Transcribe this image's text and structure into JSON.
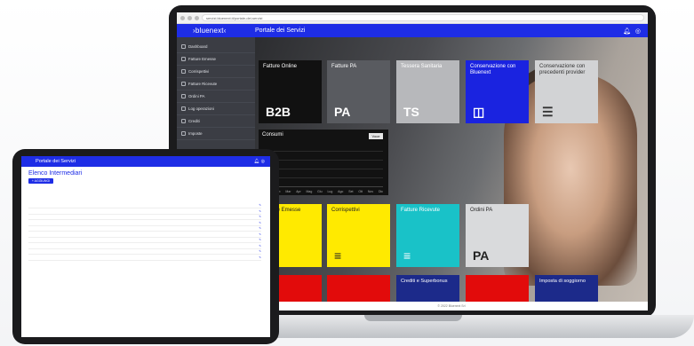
{
  "browser": {
    "url": "servizi.bluenext.it/portale-dei-servizi"
  },
  "app": {
    "brand": "›bluenext‹",
    "title": "Portale dei Servizi",
    "bell_icon": "bell-icon",
    "user_icon": "user-icon"
  },
  "sidebar": {
    "items": [
      {
        "label": "Dashboard"
      },
      {
        "label": "Fatture Emesse"
      },
      {
        "label": "Corrispettivi"
      },
      {
        "label": "Fatture Ricevute"
      },
      {
        "label": "Ordini PA"
      },
      {
        "label": "Log operazioni"
      },
      {
        "label": "Crediti"
      },
      {
        "label": "Imposte"
      }
    ]
  },
  "tiles": {
    "b2b": {
      "label": "Fatture Online",
      "icon": "B2B"
    },
    "fpa": {
      "label": "Fatture PA",
      "icon": "PA"
    },
    "ts": {
      "label": "Tessera Sanitaria",
      "icon": "TS"
    },
    "cons": {
      "label": "Conservazione con Bluenext",
      "icon": "◫"
    },
    "consprev": {
      "label": "Conservazione con precedenti provider",
      "icon": "☰"
    },
    "fe": {
      "label": "Fatture Emesse",
      "icon": "≡"
    },
    "comp": {
      "label": "Corrispettivi",
      "icon": "≡"
    },
    "fric": {
      "label": "Fatture Ricevute",
      "icon": "≡"
    },
    "opa": {
      "label": "Ordini PA",
      "icon": "PA"
    }
  },
  "consumi": {
    "title": "Consumi",
    "chip": "Voce",
    "months": [
      "Gen",
      "Feb",
      "Mar",
      "Apr",
      "Mag",
      "Giu",
      "Lug",
      "Ago",
      "Set",
      "Ott",
      "Nov",
      "Dic"
    ]
  },
  "row3": {
    "a": "",
    "b": "",
    "c": "Crediti e Superbonus",
    "d": "",
    "e": "Imposta di soggiorno"
  },
  "footer": {
    "text": "© 2022 Bluenext Srl"
  },
  "tablet": {
    "title": "Portale dei Servizi",
    "page_title": "Elenco Intermediari",
    "add_button": "+ AGGIUNGI",
    "columns": [
      "",
      "",
      "",
      "",
      "",
      "",
      "",
      ""
    ],
    "rows": [
      [
        "",
        "",
        "",
        "",
        "",
        "",
        "",
        ""
      ],
      [
        "",
        "",
        "",
        "",
        "",
        "",
        "",
        ""
      ],
      [
        "",
        "",
        "",
        "",
        "",
        "",
        "",
        ""
      ],
      [
        "",
        "",
        "",
        "",
        "",
        "",
        "",
        ""
      ],
      [
        "",
        "",
        "",
        "",
        "",
        "",
        "",
        ""
      ],
      [
        "",
        "",
        "",
        "",
        "",
        "",
        "",
        ""
      ],
      [
        "",
        "",
        "",
        "",
        "",
        "",
        "",
        ""
      ],
      [
        "",
        "",
        "",
        "",
        "",
        "",
        "",
        ""
      ],
      [
        "",
        "",
        "",
        "",
        "",
        "",
        "",
        ""
      ],
      [
        "",
        "",
        "",
        "",
        "",
        "",
        "",
        ""
      ]
    ]
  },
  "colors": {
    "brand_blue": "#1e2de6",
    "yellow": "#ffea00",
    "red": "#e20b0b",
    "teal": "#19c2c8",
    "navy": "#1c2a8a"
  }
}
